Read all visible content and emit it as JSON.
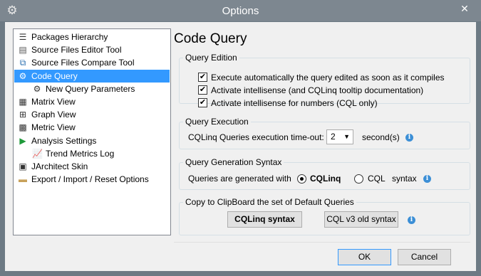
{
  "window": {
    "title": "Options",
    "app_icon": "gear-icon",
    "close_glyph": "✕"
  },
  "tree": {
    "items": [
      {
        "label": "Packages Hierarchy",
        "icon": "tree-icon",
        "glyph": "☰",
        "color": "#333333"
      },
      {
        "label": "Source Files Editor Tool",
        "icon": "file-editor-icon",
        "glyph": "▤",
        "color": "#555555"
      },
      {
        "label": "Source Files Compare Tool",
        "icon": "compare-icon",
        "glyph": "⧉",
        "color": "#2a6fb0"
      },
      {
        "label": "Code Query",
        "icon": "gear-icon",
        "glyph": "⚙",
        "color": "#ffffff",
        "selected": true
      },
      {
        "label": "New Query Parameters",
        "icon": "gears-icon",
        "glyph": "⚙",
        "color": "#333333",
        "child": true
      },
      {
        "label": "Matrix View",
        "icon": "matrix-icon",
        "glyph": "▦",
        "color": "#333333"
      },
      {
        "label": "Graph View",
        "icon": "graph-icon",
        "glyph": "⊞",
        "color": "#333333"
      },
      {
        "label": "Metric View",
        "icon": "metric-icon",
        "glyph": "▩",
        "color": "#333333"
      },
      {
        "label": "Analysis Settings",
        "icon": "play-icon",
        "glyph": "▶",
        "color": "#1f9a3a"
      },
      {
        "label": "Trend Metrics Log",
        "icon": "trend-icon",
        "glyph": "📈",
        "color": "#2a6fb0",
        "child": true
      },
      {
        "label": "JArchitect Skin",
        "icon": "skin-icon",
        "glyph": "▣",
        "color": "#333333"
      },
      {
        "label": "Export / Import / Reset Options",
        "icon": "folder-icon",
        "glyph": "▬",
        "color": "#c8a15a"
      }
    ]
  },
  "page": {
    "heading": "Code Query",
    "edition": {
      "legend": "Query Edition",
      "options": [
        {
          "label": "Execute automatically the query edited as soon as it compiles",
          "checked": true
        },
        {
          "label": "Activate intellisense (and CQLinq tooltip documentation)",
          "checked": true
        },
        {
          "label": "Activate intellisense for numbers (CQL only)",
          "checked": true
        }
      ],
      "check_glyph": "✔"
    },
    "execution": {
      "legend": "Query Execution",
      "timeout_label": "CQLinq Queries execution time-out:",
      "timeout_value": "2",
      "unit": "second(s)"
    },
    "syntax": {
      "legend": "Query Generation Syntax",
      "prefix": "Queries are generated with",
      "option_cqlinq": "CQLinq",
      "option_cql": "CQL",
      "suffix": "syntax",
      "selected": "CQLinq"
    },
    "clipboard": {
      "legend": "Copy to ClipBoard the set of Default Queries",
      "cqlinq_button": "CQLinq syntax",
      "cql_button": "CQL v3 old syntax"
    },
    "info_glyph": "i"
  },
  "footer": {
    "ok": "OK",
    "cancel": "Cancel"
  }
}
